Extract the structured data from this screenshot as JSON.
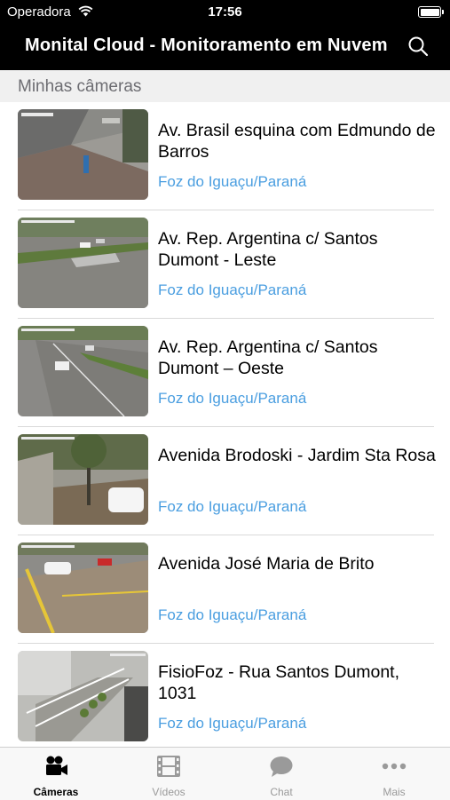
{
  "status": {
    "carrier": "Operadora",
    "time": "17:56"
  },
  "nav": {
    "title": "Monital Cloud - Monitoramento em Nuvem"
  },
  "section": {
    "title": "Minhas câmeras"
  },
  "cameras": [
    {
      "title": "Av. Brasil esquina com Edmundo de Barros",
      "location": "Foz do Iguaçu/Paraná"
    },
    {
      "title": "Av. Rep. Argentina c/ Santos Dumont - Leste",
      "location": "Foz do Iguaçu/Paraná"
    },
    {
      "title": "Av. Rep. Argentina c/ Santos Dumont – Oeste",
      "location": "Foz do Iguaçu/Paraná"
    },
    {
      "title": "Avenida Brodoski - Jardim Sta Rosa",
      "location": "Foz do Iguaçu/Paraná"
    },
    {
      "title": "Avenida José Maria de Brito",
      "location": "Foz do Iguaçu/Paraná"
    },
    {
      "title": "FisioFoz - Rua Santos Dumont, 1031",
      "location": "Foz do Iguaçu/Paraná"
    }
  ],
  "tabs": [
    {
      "label": "Câmeras",
      "icon": "video-camera-icon",
      "active": true
    },
    {
      "label": "Vídeos",
      "icon": "film-icon",
      "active": false
    },
    {
      "label": "Chat",
      "icon": "chat-bubble-icon",
      "active": false
    },
    {
      "label": "Mais",
      "icon": "more-dots-icon",
      "active": false
    }
  ],
  "colors": {
    "nav_bg": "#000000",
    "link": "#4a9ee0",
    "section_bg": "#f0f0f0",
    "active_tab": "#000000",
    "inactive_tab": "#9a9a9a"
  }
}
